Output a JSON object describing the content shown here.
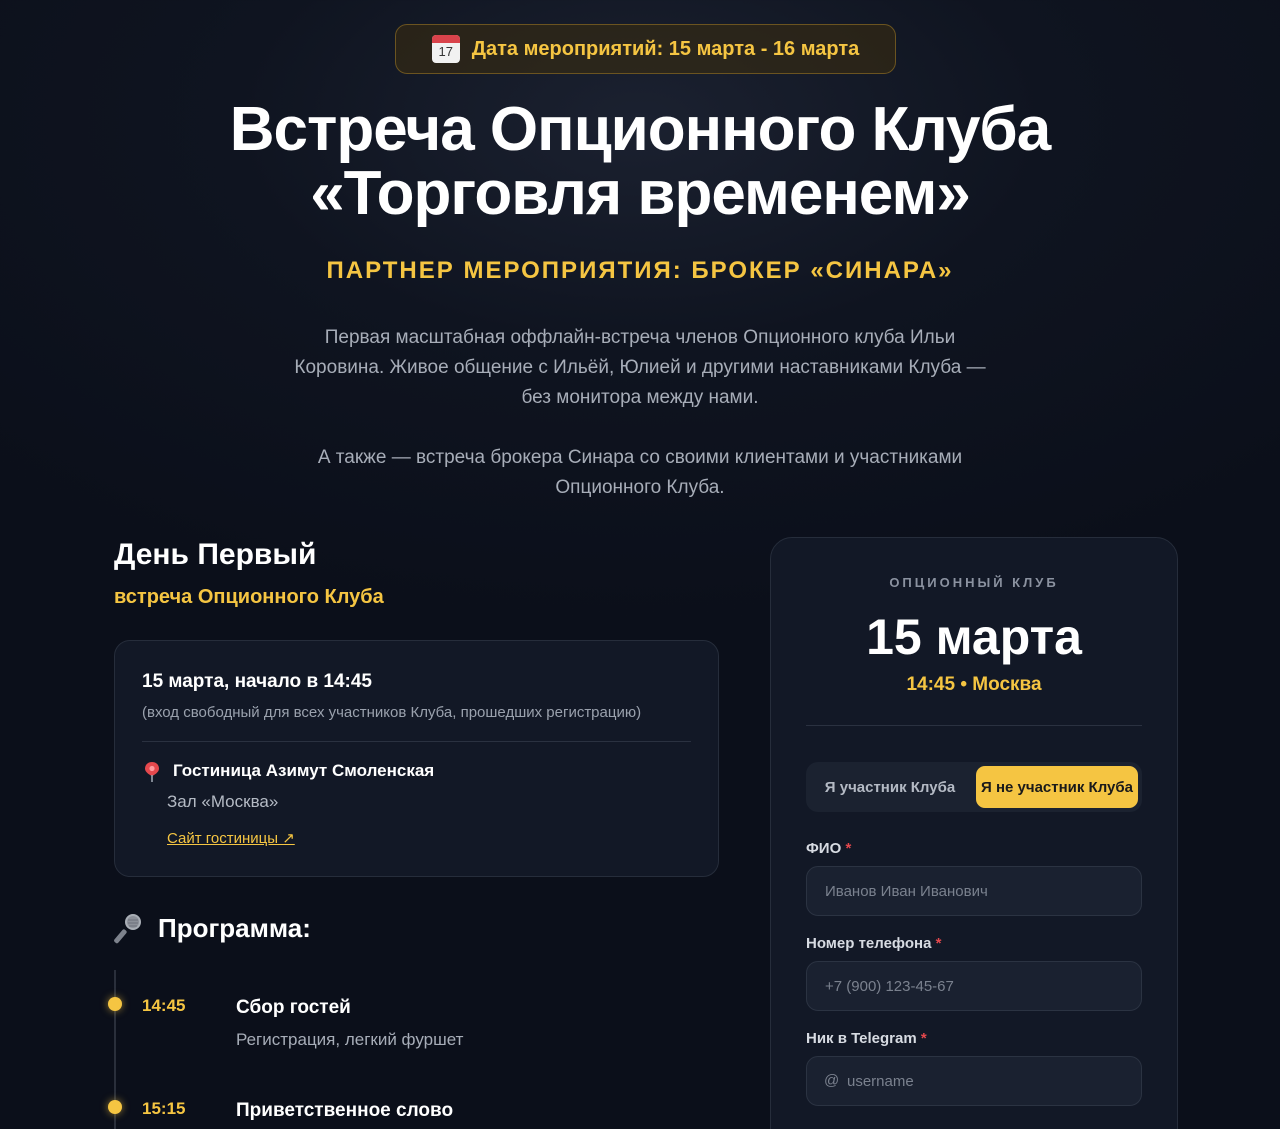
{
  "header": {
    "date_pill": "Дата мероприятий: 15 марта - 16 марта",
    "calendar_day": "17",
    "title_line1": "Встреча Опционного Клуба",
    "title_line2": "«Торговля временем»",
    "partner": "ПАРТНЕР МЕРОПРИЯТИЯ: БРОКЕР «СИНАРА»",
    "intro_1": "Первая масштабная оффлайн-встреча членов Опционного клуба Ильи Коровина. Живое общение с Ильёй, Юлией и другими наставниками Клуба — без монитора между нами.",
    "intro_2": "А также — встреча брокера Синара со своими клиентами и участниками Опционного Клуба."
  },
  "day": {
    "title": "День Первый",
    "subtitle": "встреча Опционного Клуба"
  },
  "venue": {
    "when": "15 марта, начало в 14:45",
    "note": "(вход свободный для всех участников Клуба, прошедших регистрацию)",
    "name": "Гостиница Азимут Смоленская",
    "hall": "Зал «Москва»",
    "link": "Сайт гостиницы ↗"
  },
  "program": {
    "title": "Программа:",
    "items": [
      {
        "time": "14:45",
        "name": "Сбор гостей",
        "desc": "Регистрация, легкий фуршет"
      },
      {
        "time": "15:15",
        "name": "Приветственное слово",
        "desc": ""
      }
    ]
  },
  "registration": {
    "kicker": "ОПЦИОННЫЙ КЛУБ",
    "date": "15 марта",
    "time_place": "14:45 • Москва",
    "toggle_member": "Я участник Клуба",
    "toggle_nonmember": "Я не участник Клуба",
    "fio_label": "ФИО",
    "fio_placeholder": "Иванов Иван Иванович",
    "phone_label": "Номер телефона",
    "phone_placeholder": "+7 (900) 123-45-67",
    "tg_label": "Ник в Telegram",
    "tg_prefix": "@",
    "tg_placeholder": "username",
    "required_mark": "*"
  },
  "colors": {
    "accent": "#f5c542",
    "background": "#0f1420",
    "card": "#121826",
    "required": "#e5484d"
  }
}
